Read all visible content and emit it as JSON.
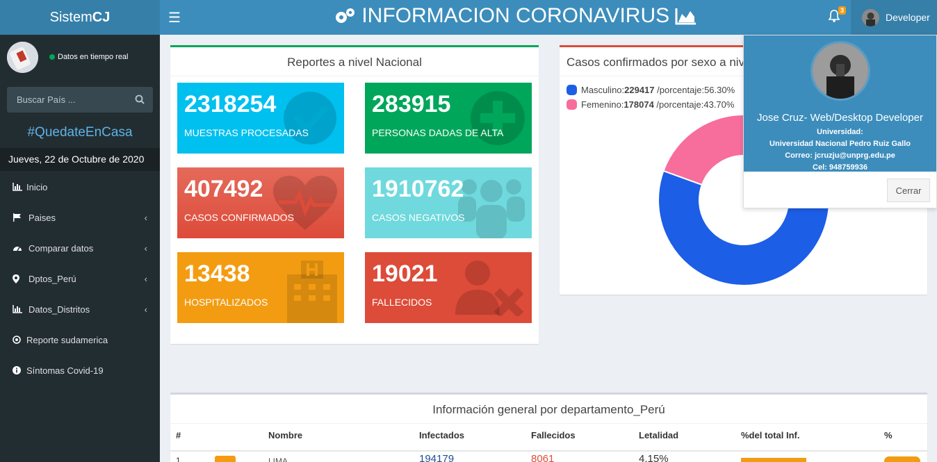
{
  "header": {
    "logo_prefix": "Sistem",
    "logo_suffix": "CJ",
    "title": "INFORMACION CORONAVIRUS",
    "notifications_count": "3",
    "user_name": "Developer"
  },
  "sidebar": {
    "status_text": "Datos en tiempo real",
    "search_placeholder": "Buscar País ...",
    "hashtag": "#QuedateEnCasa",
    "date": "Jueves, 22 de Octubre de 2020",
    "items": [
      {
        "label": "Inicio",
        "icon": "bar-chart-icon",
        "chevron": false
      },
      {
        "label": "Paises",
        "icon": "flag-icon",
        "chevron": true
      },
      {
        "label": "Comparar datos",
        "icon": "gauge-icon",
        "chevron": true
      },
      {
        "label": "Dptos_Perú",
        "icon": "map-marker-icon",
        "chevron": true
      },
      {
        "label": "Datos_Distritos",
        "icon": "bar-chart-icon",
        "chevron": true
      },
      {
        "label": "Reporte sudamerica",
        "icon": "target-icon",
        "chevron": false
      },
      {
        "label": "Síntomas Covid-19",
        "icon": "info-icon",
        "chevron": false
      }
    ]
  },
  "national": {
    "title": "Reportes a nivel Nacional",
    "tiles": [
      {
        "value": "2318254",
        "label": "MUESTRAS PROCESADAS",
        "color": "#00c0ef",
        "icon": "check-circle-icon"
      },
      {
        "value": "283915",
        "label": "PERSONAS DADAS DE ALTA",
        "color": "#00a65a",
        "icon": "plus-circle-icon"
      },
      {
        "value": "407492",
        "label": "CASOS CONFIRMADOS",
        "color": "#dd4b39",
        "icon": "heartbeat-icon"
      },
      {
        "value": "1910762",
        "label": "CASOS NEGATIVOS",
        "color": "#5bd1d7",
        "icon": "users-icon"
      },
      {
        "value": "13438",
        "label": "HOSPITALIZADOS",
        "color": "#f39c12",
        "icon": "hospital-icon"
      },
      {
        "value": "19021",
        "label": "FALLECIDOS",
        "color": "#dd4b39",
        "icon": "user-times-icon"
      }
    ]
  },
  "sex_chart": {
    "title": "Casos confirmados por sexo a nive",
    "legend": [
      {
        "label": "Masculino:",
        "value": "229417",
        "pct": " /porcentaje:56.30%"
      },
      {
        "label": "Femenino:",
        "value": "178074",
        "pct": " /porcentaje:43.70%"
      }
    ]
  },
  "chart_data": {
    "type": "pie",
    "categories": [
      "Masculino",
      "Femenino"
    ],
    "values": [
      229417,
      178074
    ],
    "colors": [
      "#1c5ee6",
      "#f76d9c"
    ],
    "donut": true
  },
  "profile": {
    "name": "Jose Cruz- Web/Desktop Developer",
    "university_label": "Universidad:",
    "university": "Universidad Nacional Pedro Ruiz Gallo",
    "email": "Correo: jcruzju@unprg.edu.pe",
    "phone": "Cel: 948759936",
    "close_label": "Cerrar"
  },
  "table": {
    "title": "Información general por departamento_Perú",
    "headers": [
      "#",
      "Nombre",
      "Infectados",
      "Fallecidos",
      "Letalidad",
      "%del total Inf.",
      "%"
    ],
    "first_row": {
      "index": "1",
      "name": "LIMA",
      "infected": "194179",
      "deaths": "8061",
      "lethality": "4.15%"
    }
  }
}
